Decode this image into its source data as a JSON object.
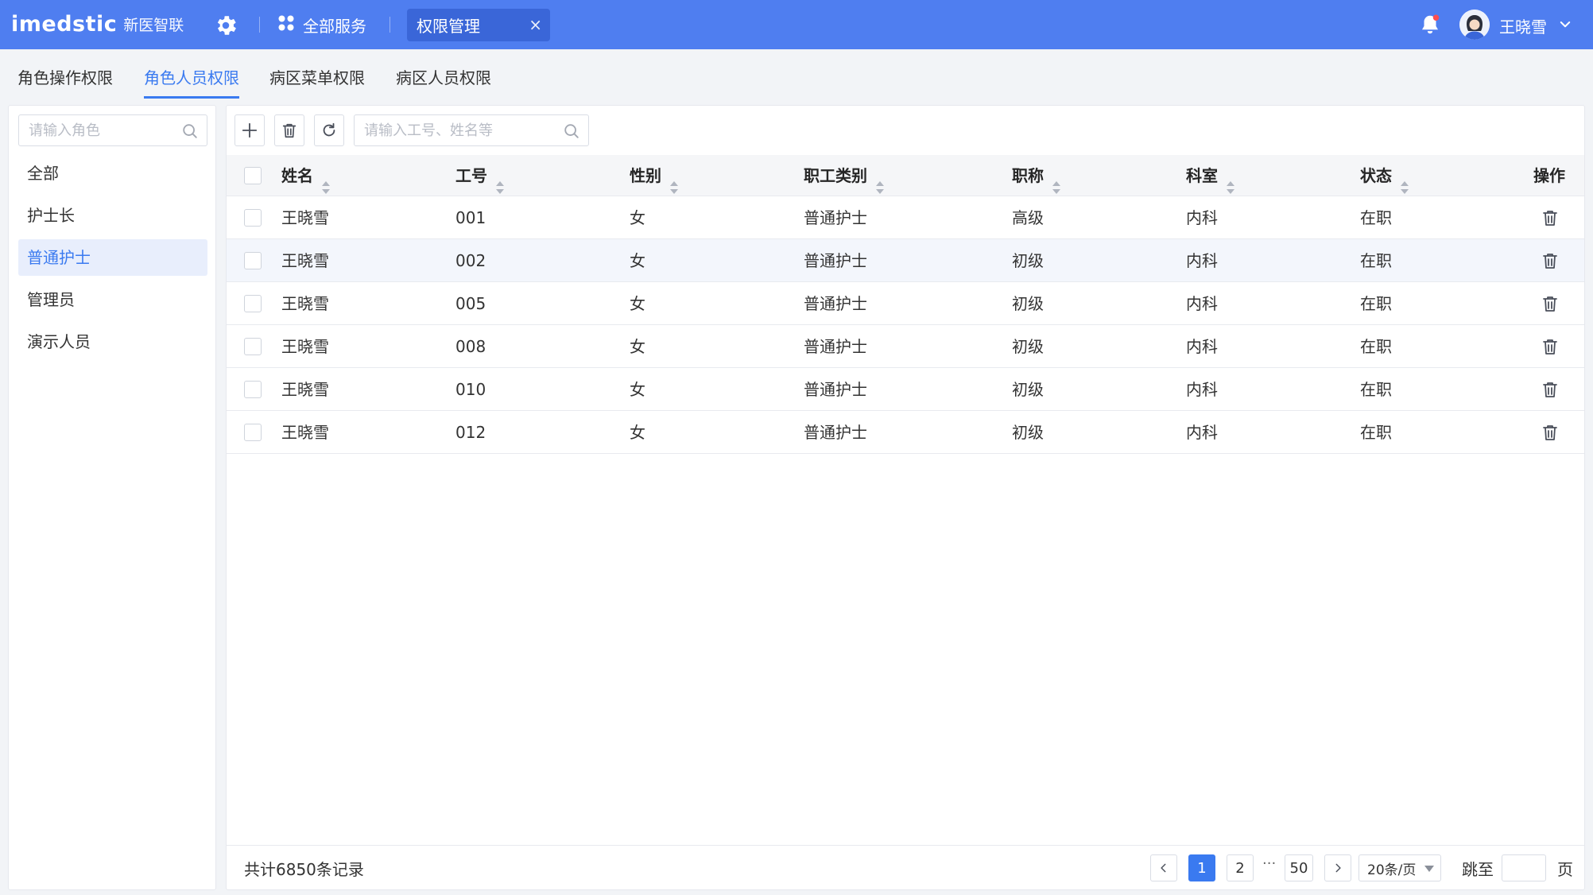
{
  "header": {
    "brand_name": "imedstic",
    "brand_sub": "新医智联",
    "all_services_label": "全部服务",
    "active_tab_label": "权限管理",
    "tab_close": "×",
    "user_name": "王晓雪"
  },
  "subtabs": [
    "角色操作权限",
    "角色人员权限",
    "病区菜单权限",
    "病区人员权限"
  ],
  "role_panel": {
    "search_placeholder": "请输入角色",
    "items": [
      "全部",
      "护士长",
      "普通护士",
      "管理员",
      "演示人员"
    ],
    "active_index": 2
  },
  "toolbar": {
    "search_placeholder": "请输入工号、姓名等"
  },
  "table": {
    "columns": [
      "姓名",
      "工号",
      "性别",
      "职工类别",
      "职称",
      "科室",
      "状态",
      "操作"
    ],
    "rows": [
      {
        "name": "王晓雪",
        "id": "001",
        "gender": "女",
        "category": "普通护士",
        "title": "高级",
        "dept": "内科",
        "status": "在职"
      },
      {
        "name": "王晓雪",
        "id": "002",
        "gender": "女",
        "category": "普通护士",
        "title": "初级",
        "dept": "内科",
        "status": "在职"
      },
      {
        "name": "王晓雪",
        "id": "005",
        "gender": "女",
        "category": "普通护士",
        "title": "初级",
        "dept": "内科",
        "status": "在职"
      },
      {
        "name": "王晓雪",
        "id": "008",
        "gender": "女",
        "category": "普通护士",
        "title": "初级",
        "dept": "内科",
        "status": "在职"
      },
      {
        "name": "王晓雪",
        "id": "010",
        "gender": "女",
        "category": "普通护士",
        "title": "初级",
        "dept": "内科",
        "status": "在职"
      },
      {
        "name": "王晓雪",
        "id": "012",
        "gender": "女",
        "category": "普通护士",
        "title": "初级",
        "dept": "内科",
        "status": "在职"
      }
    ]
  },
  "pagination": {
    "total_text": "共计6850条记录",
    "pages": [
      "1",
      "2",
      "50"
    ],
    "ellipsis": "···",
    "current_page": "1",
    "page_size": "20条/页",
    "jump_label": "跳至",
    "page_unit": "页"
  },
  "colors": {
    "header_bg": "#4f7ef0",
    "accent": "#3a7af0",
    "active_tab_bg": "#3a66d8",
    "selected_row_bg": "#f3f6fc"
  }
}
